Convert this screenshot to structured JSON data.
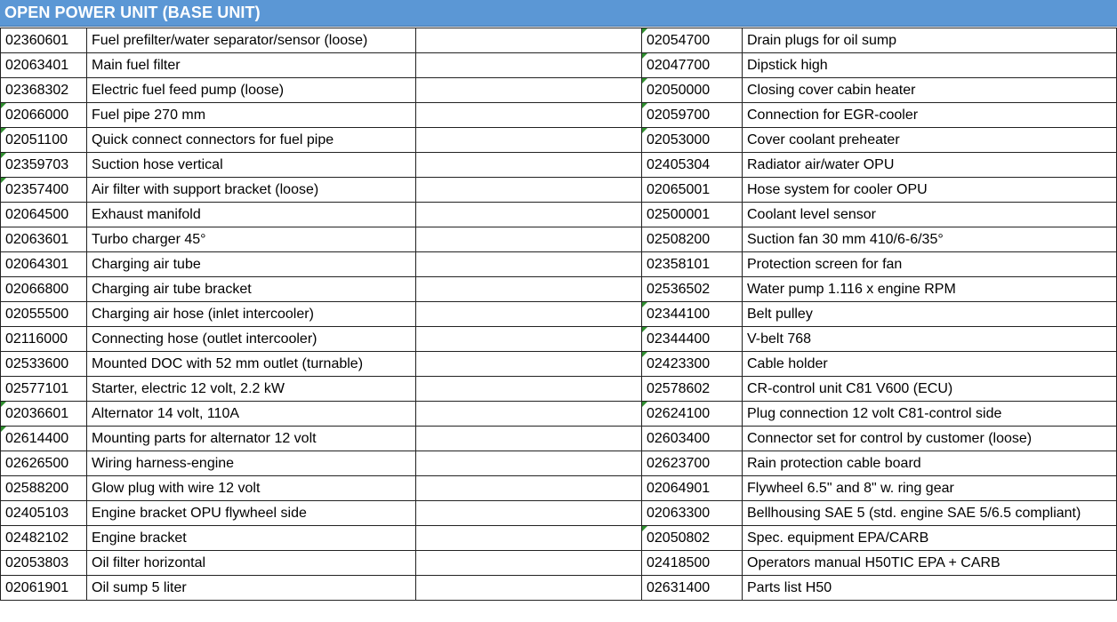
{
  "sheet": {
    "title": "OPEN POWER UNIT (BASE UNIT)",
    "header_color": "#5b97d5",
    "flag_color": "#2f8f2f",
    "left_rows": [
      {
        "code": "02360601",
        "desc": "Fuel prefilter/water separator/sensor (loose)",
        "flag": false
      },
      {
        "code": "02063401",
        "desc": "Main fuel filter",
        "flag": false
      },
      {
        "code": "02368302",
        "desc": "Electric fuel feed pump (loose)",
        "flag": false
      },
      {
        "code": "02066000",
        "desc": "Fuel pipe 270 mm",
        "flag": true
      },
      {
        "code": "02051100",
        "desc": "Quick connect connectors for fuel pipe",
        "flag": true
      },
      {
        "code": "02359703",
        "desc": "Suction hose vertical",
        "flag": true
      },
      {
        "code": "02357400",
        "desc": "Air filter with support bracket (loose)",
        "flag": true
      },
      {
        "code": "02064500",
        "desc": "Exhaust manifold",
        "flag": false
      },
      {
        "code": "02063601",
        "desc": "Turbo charger 45°",
        "flag": false
      },
      {
        "code": "02064301",
        "desc": "Charging air tube",
        "flag": false
      },
      {
        "code": "02066800",
        "desc": "Charging air tube bracket",
        "flag": false
      },
      {
        "code": "02055500",
        "desc": "Charging air hose (inlet intercooler)",
        "flag": false
      },
      {
        "code": "02116000",
        "desc": "Connecting hose (outlet intercooler)",
        "flag": false
      },
      {
        "code": "02533600",
        "desc": "Mounted DOC with 52 mm outlet (turnable)",
        "flag": false
      },
      {
        "code": "02577101",
        "desc": "Starter, electric 12 volt, 2.2 kW",
        "flag": false
      },
      {
        "code": "02036601",
        "desc": "Alternator 14 volt, 110A",
        "flag": true
      },
      {
        "code": "02614400",
        "desc": "Mounting parts for alternator 12 volt",
        "flag": true
      },
      {
        "code": "02626500",
        "desc": "Wiring harness-engine",
        "flag": false
      },
      {
        "code": "02588200",
        "desc": "Glow plug with wire 12 volt",
        "flag": false
      },
      {
        "code": "02405103",
        "desc": "Engine bracket OPU flywheel side",
        "flag": false
      },
      {
        "code": "02482102",
        "desc": "Engine bracket",
        "flag": false
      },
      {
        "code": "02053803",
        "desc": "Oil filter horizontal",
        "flag": false
      },
      {
        "code": "02061901",
        "desc": "Oil sump 5 liter",
        "flag": false
      }
    ],
    "right_rows": [
      {
        "code": "02054700",
        "desc": "Drain plugs for oil sump",
        "flag": true
      },
      {
        "code": "02047700",
        "desc": "Dipstick high",
        "flag": true
      },
      {
        "code": "02050000",
        "desc": "Closing cover cabin heater",
        "flag": true
      },
      {
        "code": "02059700",
        "desc": "Connection for EGR-cooler",
        "flag": true
      },
      {
        "code": "02053000",
        "desc": "Cover coolant preheater",
        "flag": true
      },
      {
        "code": "02405304",
        "desc": "Radiator air/water OPU",
        "flag": false
      },
      {
        "code": "02065001",
        "desc": "Hose system for cooler OPU",
        "flag": false
      },
      {
        "code": "02500001",
        "desc": "Coolant level sensor",
        "flag": false
      },
      {
        "code": "02508200",
        "desc": "Suction fan 30 mm 410/6-6/35°",
        "flag": false
      },
      {
        "code": "02358101",
        "desc": "Protection screen for fan",
        "flag": false
      },
      {
        "code": "02536502",
        "desc": "Water pump 1.116 x engine RPM",
        "flag": false
      },
      {
        "code": "02344100",
        "desc": "Belt pulley",
        "flag": true
      },
      {
        "code": "02344400",
        "desc": "V-belt 768",
        "flag": true
      },
      {
        "code": "02423300",
        "desc": "Cable holder",
        "flag": true
      },
      {
        "code": "02578602",
        "desc": "CR-control unit C81 V600 (ECU)",
        "flag": false
      },
      {
        "code": "02624100",
        "desc": "Plug connection 12 volt C81-control side",
        "flag": true
      },
      {
        "code": "02603400",
        "desc": "Connector set for control by customer (loose)",
        "flag": false
      },
      {
        "code": "02623700",
        "desc": "Rain protection cable board",
        "flag": false
      },
      {
        "code": "02064901",
        "desc": "Flywheel 6.5\" and 8\" w. ring gear",
        "flag": false
      },
      {
        "code": "02063300",
        "desc": "Bellhousing SAE 5 (std. engine SAE 5/6.5 compliant)",
        "flag": false
      },
      {
        "code": "02050802",
        "desc": "Spec. equipment EPA/CARB",
        "flag": true
      },
      {
        "code": "02418500",
        "desc": "Operators manual H50TIC EPA + CARB",
        "flag": false
      },
      {
        "code": "02631400",
        "desc": "Parts list H50",
        "flag": false
      }
    ]
  }
}
